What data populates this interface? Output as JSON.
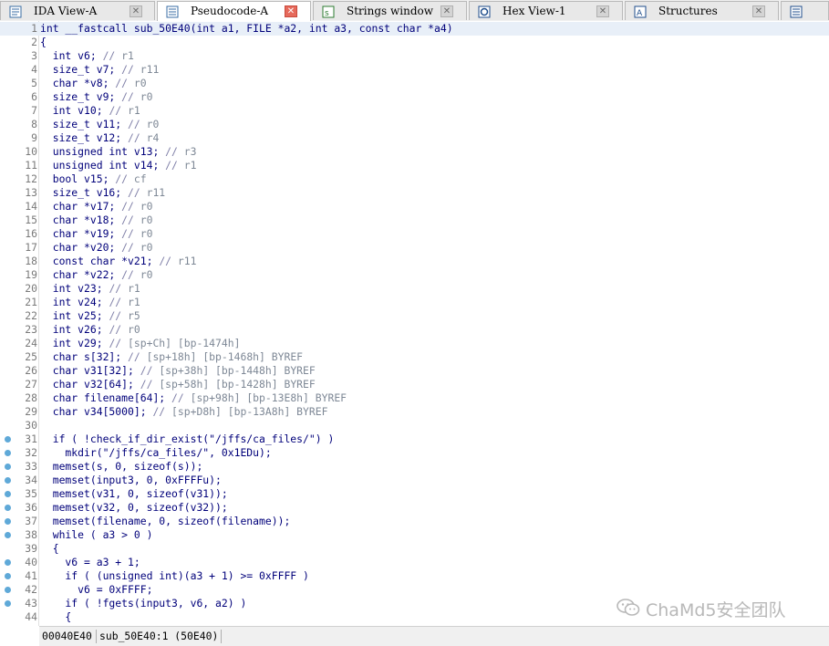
{
  "tabs": [
    {
      "label": "IDA View-A",
      "icon": "ida-view-icon",
      "active": false
    },
    {
      "label": "Pseudocode-A",
      "icon": "pseudocode-icon",
      "active": true
    },
    {
      "label": "Strings window",
      "icon": "strings-icon",
      "active": false
    },
    {
      "label": "Hex View-1",
      "icon": "hex-view-icon",
      "active": false
    },
    {
      "label": "Structures",
      "icon": "structures-icon",
      "active": false
    },
    {
      "label": "",
      "icon": "enums-icon",
      "active": false
    }
  ],
  "code_lines": [
    {
      "n": "1",
      "text": "int __fastcall sub_50E40(int a1, FILE *a2, int a3, const char *a4)",
      "bp": false
    },
    {
      "n": "2",
      "text": "{",
      "bp": false
    },
    {
      "n": "3",
      "text": "  int v6; // r1",
      "bp": false
    },
    {
      "n": "4",
      "text": "  size_t v7; // r11",
      "bp": false
    },
    {
      "n": "5",
      "text": "  char *v8; // r0",
      "bp": false
    },
    {
      "n": "6",
      "text": "  size_t v9; // r0",
      "bp": false
    },
    {
      "n": "7",
      "text": "  int v10; // r1",
      "bp": false
    },
    {
      "n": "8",
      "text": "  size_t v11; // r0",
      "bp": false
    },
    {
      "n": "9",
      "text": "  size_t v12; // r4",
      "bp": false
    },
    {
      "n": "10",
      "text": "  unsigned int v13; // r3",
      "bp": false
    },
    {
      "n": "11",
      "text": "  unsigned int v14; // r1",
      "bp": false
    },
    {
      "n": "12",
      "text": "  bool v15; // cf",
      "bp": false
    },
    {
      "n": "13",
      "text": "  size_t v16; // r11",
      "bp": false
    },
    {
      "n": "14",
      "text": "  char *v17; // r0",
      "bp": false
    },
    {
      "n": "15",
      "text": "  char *v18; // r0",
      "bp": false
    },
    {
      "n": "16",
      "text": "  char *v19; // r0",
      "bp": false
    },
    {
      "n": "17",
      "text": "  char *v20; // r0",
      "bp": false
    },
    {
      "n": "18",
      "text": "  const char *v21; // r11",
      "bp": false
    },
    {
      "n": "19",
      "text": "  char *v22; // r0",
      "bp": false
    },
    {
      "n": "20",
      "text": "  int v23; // r1",
      "bp": false
    },
    {
      "n": "21",
      "text": "  int v24; // r1",
      "bp": false
    },
    {
      "n": "22",
      "text": "  int v25; // r5",
      "bp": false
    },
    {
      "n": "23",
      "text": "  int v26; // r0",
      "bp": false
    },
    {
      "n": "24",
      "text": "  int v29; // [sp+Ch] [bp-1474h]",
      "bp": false
    },
    {
      "n": "25",
      "text": "  char s[32]; // [sp+18h] [bp-1468h] BYREF",
      "bp": false
    },
    {
      "n": "26",
      "text": "  char v31[32]; // [sp+38h] [bp-1448h] BYREF",
      "bp": false
    },
    {
      "n": "27",
      "text": "  char v32[64]; // [sp+58h] [bp-1428h] BYREF",
      "bp": false
    },
    {
      "n": "28",
      "text": "  char filename[64]; // [sp+98h] [bp-13E8h] BYREF",
      "bp": false
    },
    {
      "n": "29",
      "text": "  char v34[5000]; // [sp+D8h] [bp-13A8h] BYREF",
      "bp": false
    },
    {
      "n": "30",
      "text": "",
      "bp": false
    },
    {
      "n": "31",
      "text": "  if ( !check_if_dir_exist(\"/jffs/ca_files/\") )",
      "bp": true
    },
    {
      "n": "32",
      "text": "    mkdir(\"/jffs/ca_files/\", 0x1EDu);",
      "bp": true
    },
    {
      "n": "33",
      "text": "  memset(s, 0, sizeof(s));",
      "bp": true
    },
    {
      "n": "34",
      "text": "  memset(input3, 0, 0xFFFFu);",
      "bp": true
    },
    {
      "n": "35",
      "text": "  memset(v31, 0, sizeof(v31));",
      "bp": true
    },
    {
      "n": "36",
      "text": "  memset(v32, 0, sizeof(v32));",
      "bp": true
    },
    {
      "n": "37",
      "text": "  memset(filename, 0, sizeof(filename));",
      "bp": true
    },
    {
      "n": "38",
      "text": "  while ( a3 > 0 )",
      "bp": true
    },
    {
      "n": "39",
      "text": "  {",
      "bp": false
    },
    {
      "n": "40",
      "text": "    v6 = a3 + 1;",
      "bp": true
    },
    {
      "n": "41",
      "text": "    if ( (unsigned int)(a3 + 1) >= 0xFFFF )",
      "bp": true
    },
    {
      "n": "42",
      "text": "      v6 = 0xFFFF;",
      "bp": true
    },
    {
      "n": "43",
      "text": "    if ( !fgets(input3, v6, a2) )",
      "bp": true
    },
    {
      "n": "44",
      "text": "    {",
      "bp": false
    }
  ],
  "status": {
    "address": "00040E40",
    "location": "sub_50E40:1 (50E40)"
  },
  "watermark": "ChaMd5安全团队",
  "colors": {
    "code": "#00007a",
    "comment": "#8080a8",
    "breakpoint": "#5fa9d8",
    "active_close": "#e66a5c"
  }
}
